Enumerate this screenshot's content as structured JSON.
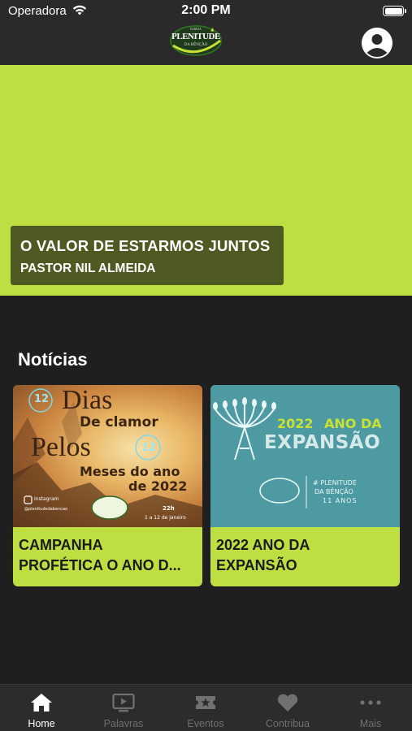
{
  "status_bar": {
    "carrier": "Operadora",
    "time": "2:00 PM"
  },
  "header": {
    "logo": {
      "top_text": "IGREJA",
      "main_text": "PLENITUDE",
      "sub_text": "DA BÊNÇÃO"
    },
    "profile_icon": "account-circle-icon"
  },
  "hero": {
    "background_color": "#bedf41",
    "title": "O VALOR DE ESTARMOS JUNTOS",
    "subtitle": "PASTOR NIL ALMEIDA"
  },
  "news": {
    "section_title": "Notícias",
    "cards": [
      {
        "image": {
          "badge_top": "12",
          "line1": "Dias",
          "line2": "De clamor",
          "line3": "Pelos",
          "badge_mid": "12",
          "line4": "Meses do ano",
          "line5": "de 2022",
          "instagram_label": "Instagram",
          "instagram_handle": "@plenitudedabencao",
          "time": "22h",
          "dates": "1 a 12 de janeiro"
        },
        "title_line1": "CAMPANHA",
        "title_line2": "PROFÉTICA O ANO D..."
      },
      {
        "image": {
          "year": "2022",
          "heading": "ANO DA",
          "expansion": "EXPANSÃO",
          "tag_line1": "# PLENITUDE",
          "tag_line2": "DA BÊNÇÃO",
          "tag_line3": "11 ANOS"
        },
        "title_line1": "2022 ANO DA",
        "title_line2": "EXPANSÃO"
      }
    ]
  },
  "tab_bar": {
    "tabs": [
      {
        "label": "Home",
        "icon": "home-icon",
        "active": true
      },
      {
        "label": "Palavras",
        "icon": "tv-play-icon",
        "active": false
      },
      {
        "label": "Eventos",
        "icon": "ticket-star-icon",
        "active": false
      },
      {
        "label": "Contribua",
        "icon": "heart-icon",
        "active": false
      },
      {
        "label": "Mais",
        "icon": "more-dots-icon",
        "active": false
      }
    ]
  },
  "colors": {
    "accent": "#bedf41",
    "caption_bg": "#4f5a22",
    "background": "#1f1f1f",
    "bars": "#2a2a2a"
  }
}
